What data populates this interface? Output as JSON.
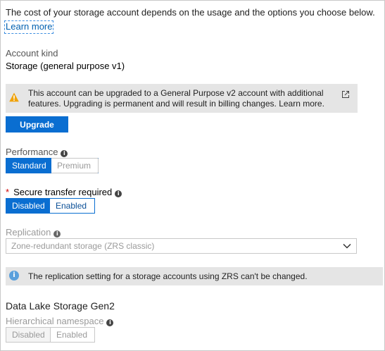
{
  "intro_text": "The cost of your storage account depends on the usage and the options you choose below.",
  "learn_more": "Learn more",
  "account_kind": {
    "label": "Account kind",
    "value": "Storage (general purpose v1)"
  },
  "upgrade_notice": {
    "text": "This account can be upgraded to a General Purpose v2 account with additional features. Upgrading is permanent and will result in billing changes. Learn more.",
    "icon": "warning-icon",
    "link_icon": "external-link-icon"
  },
  "upgrade_button": "Upgrade",
  "performance": {
    "label": "Performance",
    "options": [
      "Standard",
      "Premium"
    ],
    "selected": "Standard"
  },
  "secure_transfer": {
    "required_mark": "*",
    "label": "Secure transfer required",
    "options": [
      "Disabled",
      "Enabled"
    ],
    "selected": "Disabled"
  },
  "replication": {
    "label": "Replication",
    "value": "Zone-redundant storage (ZRS classic)"
  },
  "replication_notice": "The replication setting for a storage accounts using ZRS can't be changed.",
  "data_lake": {
    "title": "Data Lake Storage Gen2",
    "hns_label": "Hierarchical namespace",
    "options": [
      "Disabled",
      "Enabled"
    ]
  },
  "colors": {
    "accent": "#0a6ed1",
    "warning": "#f0a30a",
    "info": "#5aa0dc"
  }
}
